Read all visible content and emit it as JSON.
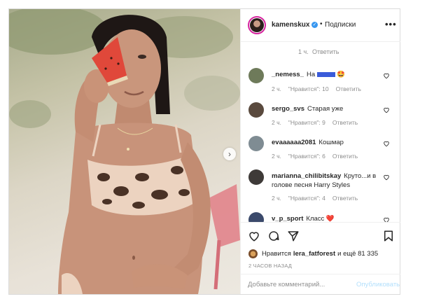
{
  "header": {
    "username": "kamenskux",
    "separator": "•",
    "follow_label": "Подписки"
  },
  "reply_row": {
    "age": "1 ч.",
    "reply_label": "Ответить"
  },
  "comments": [
    {
      "username": "_nemess_",
      "text": "На",
      "emoji": "🤩",
      "age": "2 ч.",
      "likes": "\"Нравится\": 10",
      "reply": "Ответить",
      "avatar_color": "#6e7a5a"
    },
    {
      "username": "sergo_svs",
      "text": "Старая уже",
      "age": "2 ч.",
      "likes": "\"Нравится\": 9",
      "reply": "Ответить",
      "avatar_color": "#5a4a3e"
    },
    {
      "username": "evaaaaaa2081",
      "text": "Кошмар",
      "age": "2 ч.",
      "likes": "\"Нравится\": 6",
      "reply": "Ответить",
      "avatar_color": "#7f8c93"
    },
    {
      "username": "marianna_chilibitskay",
      "text": "Круто...и в голове песня Harry Styles",
      "age": "2 ч.",
      "likes": "\"Нравится\": 4",
      "reply": "Ответить",
      "avatar_color": "#3e3a38"
    },
    {
      "username": "v_p_sport",
      "text": "Класс",
      "emoji": "❤️",
      "age": "",
      "likes": "",
      "reply": "",
      "avatar_color": "#3b4a6b"
    }
  ],
  "likes": {
    "prefix": "Нравится",
    "user": "lera_fatforest",
    "suffix": "и ещё 81 335"
  },
  "time_ago": "2 ЧАСОВ НАЗАД",
  "add_comment": {
    "placeholder": "Добавьте комментарий...",
    "publish_label": "Опубликовать"
  },
  "colors": {
    "accent_blue": "#3897f0",
    "publish_disabled": "#b2dffc",
    "muted_text": "#8e8e8e",
    "avatar_ring": "#d6249f"
  },
  "icons": [
    "next-arrow-icon",
    "verified-icon",
    "more-options-icon",
    "heart-icon",
    "comment-icon",
    "share-icon",
    "bookmark-icon"
  ]
}
